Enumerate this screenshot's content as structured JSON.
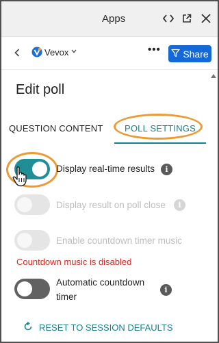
{
  "appbar": {
    "title": "Apps",
    "icons": [
      "code-icon",
      "popout-icon",
      "close-icon"
    ]
  },
  "toolbar": {
    "app_name": "Vevox",
    "more_label": "•••",
    "share_label": "Share"
  },
  "page": {
    "title": "Edit poll"
  },
  "tabs": [
    {
      "label": "QUESTION CONTENT",
      "active": false
    },
    {
      "label": "POLL SETTINGS",
      "active": true
    }
  ],
  "settings": [
    {
      "label": "Display real-time results",
      "state": "on",
      "has_info": true
    },
    {
      "label": "Display result on poll close",
      "state": "disabled",
      "has_info": true
    },
    {
      "label": "Enable countdown timer music",
      "state": "disabled",
      "has_info": false
    },
    {
      "label_line1": "Automatic countdown",
      "label_line2": "timer",
      "state": "off",
      "has_info": true
    }
  ],
  "error": {
    "text": "Countdown music is disabled"
  },
  "reset": {
    "label": "RESET TO SESSION DEFAULTS"
  },
  "colors": {
    "accent": "#14838c",
    "toggle_on": "#1f8f95",
    "share": "#1468d8",
    "highlight": "#ec9a35",
    "error": "#d32a20"
  }
}
